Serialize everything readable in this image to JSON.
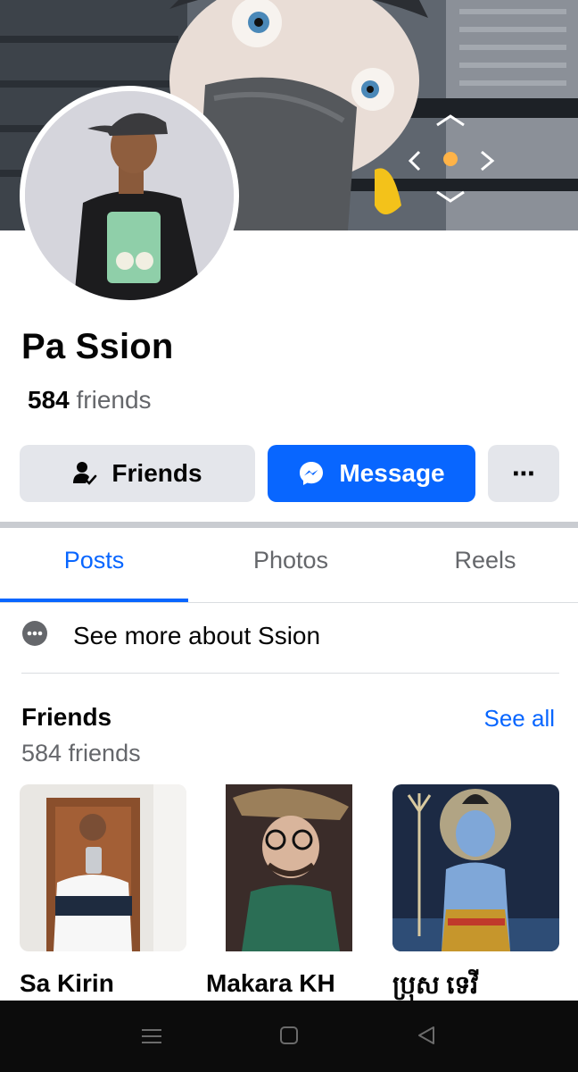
{
  "profile": {
    "name": "Pa Ssion",
    "friends_number": "584",
    "friends_label": "friends"
  },
  "actions": {
    "friends_label": "Friends",
    "message_label": "Message",
    "more_label": "⋯"
  },
  "tabs": [
    {
      "label": "Posts",
      "active": true
    },
    {
      "label": "Photos",
      "active": false
    },
    {
      "label": "Reels",
      "active": false
    }
  ],
  "about": {
    "label": "See more about Ssion"
  },
  "friends_section": {
    "title": "Friends",
    "see_all": "See all",
    "count_text": "584 friends",
    "friends": [
      {
        "name": "Sa Kirin"
      },
      {
        "name": "Makara KH"
      },
      {
        "name": "ប្រុស ទេវី"
      }
    ]
  },
  "colors": {
    "accent": "#0866ff",
    "secondary_button": "#e4e6eb",
    "muted_text": "#65676b"
  }
}
